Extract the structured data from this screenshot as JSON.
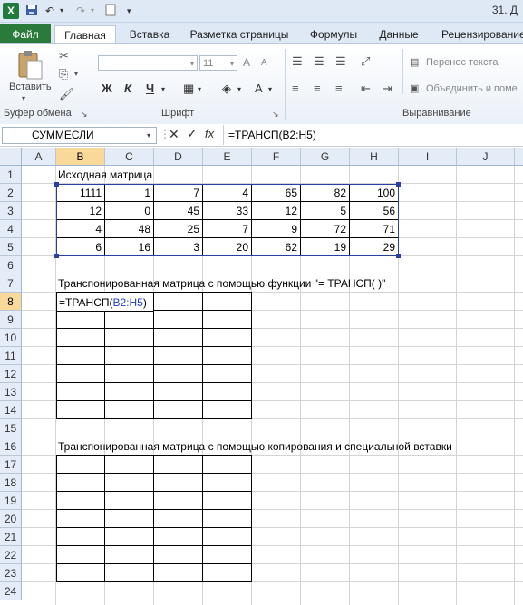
{
  "titlebar": {
    "logo": "X",
    "title": "31. Д",
    "icons": [
      "save-icon",
      "undo-icon",
      "redo-icon",
      "new-file-icon"
    ]
  },
  "tabs": [
    "Файл",
    "Главная",
    "Вставка",
    "Разметка страницы",
    "Формулы",
    "Данные",
    "Рецензирование"
  ],
  "ribbon": {
    "clipboard": {
      "paste": "Вставить",
      "group": "Буфер обмена"
    },
    "font": {
      "size": "11",
      "bold": "Ж",
      "italic": "К",
      "underline": "Ч",
      "font_color": "A",
      "grow": "A",
      "group": "Шрифт"
    },
    "alignment": {
      "wrap": "Перенос текста",
      "merge": "Объединить и поме",
      "group": "Выравнивание"
    }
  },
  "formula_bar": {
    "name_box": "СУММЕСЛИ",
    "fx": "fx",
    "formula": "=ТРАНСП(B2:H5)"
  },
  "columns": [
    "A",
    "B",
    "C",
    "D",
    "E",
    "F",
    "G",
    "H",
    "I",
    "J"
  ],
  "rows": [
    "1",
    "2",
    "3",
    "4",
    "5",
    "6",
    "7",
    "8",
    "9",
    "10",
    "11",
    "12",
    "13",
    "14",
    "15",
    "16",
    "17",
    "18",
    "19",
    "20",
    "21",
    "22",
    "23",
    "24"
  ],
  "sheet": {
    "title1": "Исходная матрица",
    "matrix": [
      [
        "1111",
        "1",
        "7",
        "4",
        "65",
        "82",
        "100"
      ],
      [
        "12",
        "0",
        "45",
        "33",
        "12",
        "5",
        "56"
      ],
      [
        "4",
        "48",
        "25",
        "7",
        "9",
        "72",
        "71"
      ],
      [
        "6",
        "16",
        "3",
        "20",
        "62",
        "19",
        "29"
      ]
    ],
    "title2": "Транспонированная матрица с помощью функции \"= ТРАНСП( )\"",
    "edit_prefix": "=ТРАНСП(",
    "edit_ref": "B2:H5",
    "edit_suffix": ")",
    "title3": "Транспонированная матрица с помощью копирования и специальной вставки"
  },
  "colors": {
    "accent_green": "#2a7a3b",
    "selection": "#f9d99a",
    "ref_blue": "#1f3fbf",
    "matrix_border": "#2b3f9e"
  }
}
